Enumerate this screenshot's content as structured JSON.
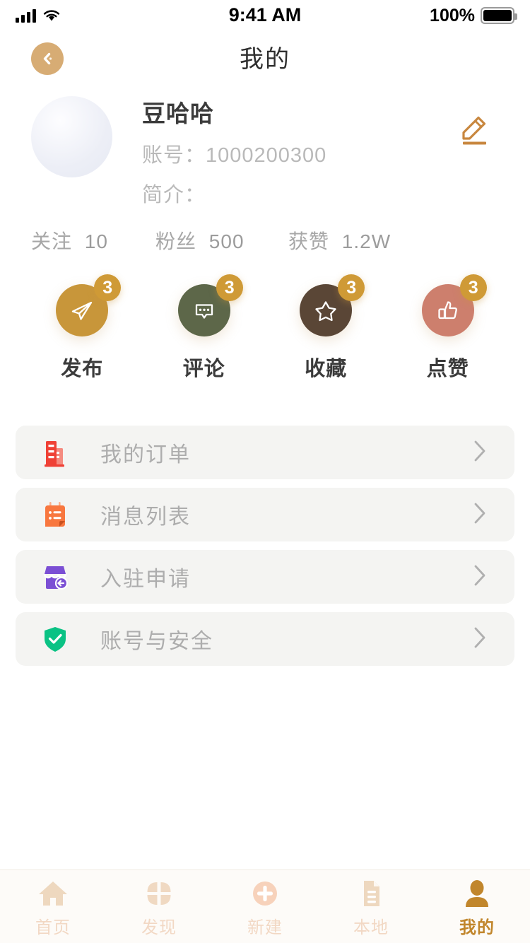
{
  "status_bar": {
    "time": "9:41 AM",
    "battery_percent": "100%",
    "signal_icon": "signal-bars-icon",
    "wifi_icon": "wifi-icon",
    "battery_icon": "battery-full-icon"
  },
  "header": {
    "title": "我的",
    "back_icon": "chevron-left-icon"
  },
  "profile": {
    "avatar_icon": "avatar-placeholder",
    "name": "豆哈哈",
    "account_label": "账号：1000200300",
    "bio_label": "简介：",
    "edit_icon": "pencil-edit-icon",
    "follow_stats": [
      {
        "label": "关注",
        "value": "10"
      },
      {
        "label": "粉丝",
        "value": "500"
      },
      {
        "label": "获赞",
        "value": "1.2W"
      }
    ]
  },
  "icon_stats": [
    {
      "label": "发布",
      "badge": "3",
      "icon": "paper-plane-icon",
      "color": "#c8963a"
    },
    {
      "label": "评论",
      "badge": "3",
      "icon": "comment-bubble-icon",
      "color": "#5d6749"
    },
    {
      "label": "收藏",
      "badge": "3",
      "icon": "star-icon",
      "color": "#5a4636"
    },
    {
      "label": "点赞",
      "badge": "3",
      "icon": "thumbs-up-icon",
      "color": "#cd7f6d"
    }
  ],
  "menu": {
    "chevron_icon": "chevron-right-icon",
    "items": [
      {
        "label": "我的订单",
        "icon": "building-invoice-icon",
        "color": "#ef4136"
      },
      {
        "label": "消息列表",
        "icon": "notepad-list-icon",
        "color": "#f8773f"
      },
      {
        "label": "入驻申请",
        "icon": "storefront-icon",
        "color": "#7b4fd4"
      },
      {
        "label": "账号与安全",
        "icon": "shield-check-icon",
        "color": "#0ac284"
      }
    ]
  },
  "tab_bar": {
    "items": [
      {
        "label": "首页",
        "icon": "home-icon",
        "active": false
      },
      {
        "label": "发现",
        "icon": "discover-clover-icon",
        "active": false
      },
      {
        "label": "新建",
        "icon": "plus-circle-icon",
        "active": false
      },
      {
        "label": "本地",
        "icon": "document-icon",
        "active": false
      },
      {
        "label": "我的",
        "icon": "person-icon",
        "active": true
      }
    ]
  },
  "theme": {
    "accent": "#c8963a",
    "back_button_bg": "#d7ac74",
    "edit_icon_color": "#c8873f",
    "tab_inactive": "#f2d8c4",
    "tab_active": "#c1862c",
    "row_bg": "#f4f4f2"
  }
}
